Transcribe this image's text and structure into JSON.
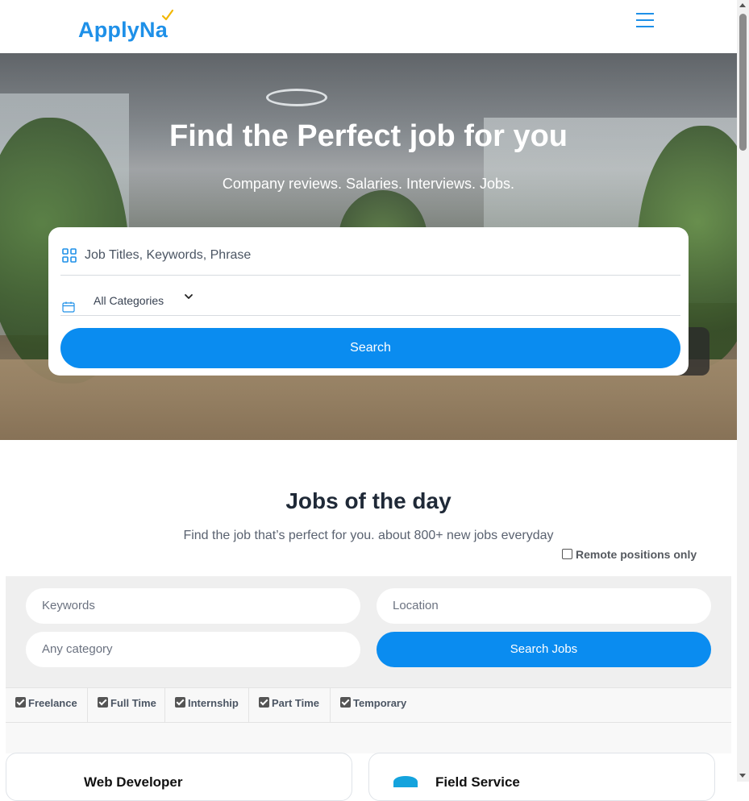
{
  "header": {
    "logo_text": "ApplyNa",
    "menu_icon": "hamburger-menu-icon"
  },
  "hero": {
    "title": "Find the Perfect job for you",
    "subtitle": "Company reviews. Salaries. Interviews. Jobs.",
    "search": {
      "keywords_placeholder": "Job Titles, Keywords, Phrase",
      "category_value": "All Categories",
      "button_label": "Search"
    }
  },
  "jobs_section": {
    "title": "Jobs of the day",
    "subtitle": "Find the job that’s perfect for you. about 800+ new jobs everyday",
    "remote_label": "Remote positions only",
    "remote_checked": false,
    "filters": {
      "keywords_placeholder": "Keywords",
      "location_placeholder": "Location",
      "category_placeholder": "Any category",
      "button_label": "Search Jobs"
    },
    "job_types": [
      {
        "label": "Freelance",
        "checked": true
      },
      {
        "label": "Full Time",
        "checked": true
      },
      {
        "label": "Internship",
        "checked": true
      },
      {
        "label": "Part Time",
        "checked": true
      },
      {
        "label": "Temporary",
        "checked": true
      }
    ],
    "jobs": [
      {
        "title": "Web Developer"
      },
      {
        "title": "Field Service"
      }
    ]
  },
  "colors": {
    "brand": "#1e90e8",
    "button": "#0a8cf0",
    "logo_check": "#f2b705"
  }
}
